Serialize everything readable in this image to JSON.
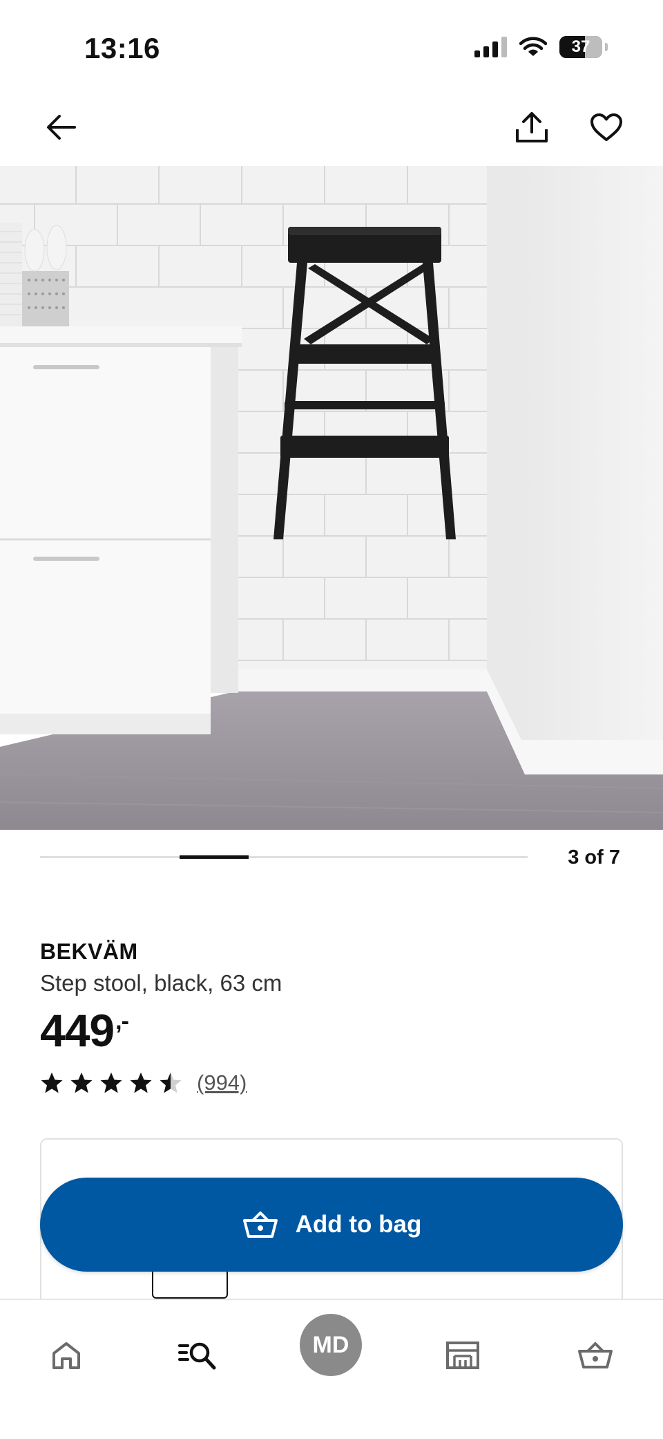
{
  "status_bar": {
    "time": "13:16",
    "battery": "37",
    "icons": [
      "signal-icon",
      "wifi-icon",
      "battery-icon"
    ]
  },
  "topbar": {
    "icons": [
      "back-arrow-icon",
      "share-icon",
      "heart-icon"
    ]
  },
  "carousel": {
    "counter": "3 of 7",
    "position": 3,
    "total": 7
  },
  "product": {
    "name": "BEKVÄM",
    "description": "Step stool, black, 63 cm",
    "price": "449",
    "price_suffix": ",-",
    "rating": 4.5,
    "rating_max": 5,
    "review_count": "(994)"
  },
  "actions": {
    "add_to_bag": "Add to bag"
  },
  "bottom_nav": {
    "profile_initials": "MD",
    "items": [
      "home-icon",
      "search-icon",
      "profile",
      "stores-icon",
      "bag-icon"
    ]
  },
  "colors": {
    "accent": "#0058a3",
    "text": "#111111",
    "profile_bg": "#8a8a8a"
  }
}
